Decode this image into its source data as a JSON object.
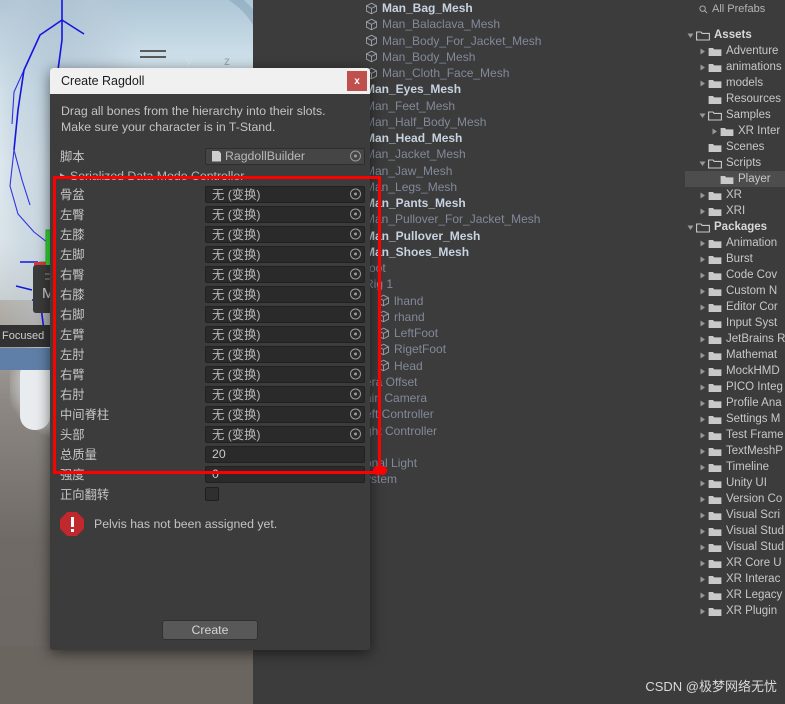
{
  "scene": {
    "gizmo_y": "y",
    "gizmo_z": "z",
    "mini_panel_label": "M",
    "focused_label": "Focused"
  },
  "dialog": {
    "title": "Create Ragdoll",
    "close_label": "x",
    "help_line1": "Drag all bones from the hierarchy into their slots.",
    "help_line2": "Make sure your character is in T-Stand.",
    "script_label": "脚本",
    "script_value": "RagdollBuilder",
    "section_header": "Serialized Data Mode Controller",
    "empty_value": "无 (变换)",
    "bone_rows": [
      {
        "label": "骨盆",
        "value": "无 (变换)"
      },
      {
        "label": "左臀",
        "value": "无 (变换)"
      },
      {
        "label": "左膝",
        "value": "无 (变换)"
      },
      {
        "label": "左脚",
        "value": "无 (变换)"
      },
      {
        "label": "右臀",
        "value": "无 (变换)"
      },
      {
        "label": "右膝",
        "value": "无 (变换)"
      },
      {
        "label": "右脚",
        "value": "无 (变换)"
      },
      {
        "label": "左臂",
        "value": "无 (变换)"
      },
      {
        "label": "左肘",
        "value": "无 (变换)"
      },
      {
        "label": "右臂",
        "value": "无 (变换)"
      },
      {
        "label": "右肘",
        "value": "无 (变换)"
      },
      {
        "label": "中间脊柱",
        "value": "无 (变换)"
      },
      {
        "label": "头部",
        "value": "无 (变换)"
      }
    ],
    "total_mass_label": "总质量",
    "total_mass_value": "20",
    "strength_label": "强度",
    "strength_value": "0",
    "flip_forward_label": "正向翻转",
    "warning_text": "Pelvis has not been assigned yet.",
    "create_label": "Create"
  },
  "hierarchy": {
    "rows": [
      {
        "label": "Man_Bag_Mesh",
        "style": "bright",
        "icon": true,
        "indent": 1
      },
      {
        "label": "Man_Balaclava_Mesh",
        "style": "dim",
        "icon": true,
        "indent": 1
      },
      {
        "label": "Man_Body_For_Jacket_Mesh",
        "style": "dim",
        "icon": true,
        "indent": 1
      },
      {
        "label": "Man_Body_Mesh",
        "style": "dim",
        "icon": true,
        "indent": 1
      },
      {
        "label": "Man_Cloth_Face_Mesh",
        "style": "dim",
        "icon": true,
        "indent": 1
      },
      {
        "label": "Man_Eyes_Mesh",
        "style": "bright",
        "icon": false,
        "indent": 1
      },
      {
        "label": "Man_Feet_Mesh",
        "style": "dim",
        "icon": false,
        "indent": 1
      },
      {
        "label": "Man_Half_Body_Mesh",
        "style": "dim",
        "icon": false,
        "indent": 1
      },
      {
        "label": "Man_Head_Mesh",
        "style": "bright",
        "icon": false,
        "indent": 1
      },
      {
        "label": "Man_Jacket_Mesh",
        "style": "dim",
        "icon": false,
        "indent": 1
      },
      {
        "label": "Man_Jaw_Mesh",
        "style": "dim",
        "icon": false,
        "indent": 1
      },
      {
        "label": "Man_Legs_Mesh",
        "style": "dim",
        "icon": false,
        "indent": 1
      },
      {
        "label": "Man_Pants_Mesh",
        "style": "bright",
        "icon": false,
        "indent": 1
      },
      {
        "label": "Man_Pullover_For_Jacket_Mesh",
        "style": "dim",
        "icon": false,
        "indent": 1
      },
      {
        "label": "Man_Pullover_Mesh",
        "style": "bright",
        "icon": false,
        "indent": 1
      },
      {
        "label": "Man_Shoes_Mesh",
        "style": "bright",
        "icon": false,
        "indent": 1
      },
      {
        "label": "root",
        "style": "dim",
        "icon": false,
        "indent": 1
      },
      {
        "label": "Rig 1",
        "style": "dim",
        "icon": false,
        "indent": 1
      },
      {
        "label": "lhand",
        "style": "dim",
        "icon": true,
        "indent": 2
      },
      {
        "label": "rhand",
        "style": "dim",
        "icon": true,
        "indent": 2
      },
      {
        "label": "LeftFoot",
        "style": "dim",
        "icon": true,
        "indent": 2
      },
      {
        "label": "RigetFoot",
        "style": "dim",
        "icon": true,
        "indent": 2
      },
      {
        "label": "Head",
        "style": "dim",
        "icon": true,
        "indent": 2
      },
      {
        "label": "era Offset",
        "style": "dim",
        "icon": false,
        "indent": 1
      },
      {
        "label": "ain Camera",
        "style": "dim",
        "icon": false,
        "indent": 1
      },
      {
        "label": "eft Controller",
        "style": "dim",
        "icon": false,
        "indent": 1
      },
      {
        "label": "ght Controller",
        "style": "dim",
        "icon": false,
        "indent": 1
      },
      {
        "label": "",
        "style": "dim",
        "icon": false,
        "indent": 1
      },
      {
        "label": "onal Light",
        "style": "dim",
        "icon": false,
        "indent": 1
      },
      {
        "label": "ystem",
        "style": "dim",
        "icon": false,
        "indent": 1
      }
    ]
  },
  "project": {
    "search_label": "All Prefabs",
    "rows": [
      {
        "label": "Assets",
        "indent": 0,
        "arrow": "down",
        "folder": "open",
        "bold": true,
        "selected": false
      },
      {
        "label": "Adventure",
        "indent": 1,
        "arrow": "right",
        "folder": "closed",
        "bold": false,
        "selected": false
      },
      {
        "label": "animations",
        "indent": 1,
        "arrow": "right",
        "folder": "closed",
        "bold": false,
        "selected": false
      },
      {
        "label": "models",
        "indent": 1,
        "arrow": "right",
        "folder": "closed",
        "bold": false,
        "selected": false
      },
      {
        "label": "Resources",
        "indent": 1,
        "arrow": "none",
        "folder": "closed",
        "bold": false,
        "selected": false
      },
      {
        "label": "Samples",
        "indent": 1,
        "arrow": "down",
        "folder": "open",
        "bold": false,
        "selected": false
      },
      {
        "label": "XR Inter",
        "indent": 2,
        "arrow": "right",
        "folder": "closed",
        "bold": false,
        "selected": false
      },
      {
        "label": "Scenes",
        "indent": 1,
        "arrow": "none",
        "folder": "closed",
        "bold": false,
        "selected": false
      },
      {
        "label": "Scripts",
        "indent": 1,
        "arrow": "down",
        "folder": "open",
        "bold": false,
        "selected": false
      },
      {
        "label": "Player",
        "indent": 2,
        "arrow": "none",
        "folder": "closed",
        "bold": false,
        "selected": true
      },
      {
        "label": "XR",
        "indent": 1,
        "arrow": "right",
        "folder": "closed",
        "bold": false,
        "selected": false
      },
      {
        "label": "XRI",
        "indent": 1,
        "arrow": "right",
        "folder": "closed",
        "bold": false,
        "selected": false
      },
      {
        "label": "Packages",
        "indent": 0,
        "arrow": "down",
        "folder": "open",
        "bold": true,
        "selected": false
      },
      {
        "label": "Animation",
        "indent": 1,
        "arrow": "right",
        "folder": "closed",
        "bold": false,
        "selected": false
      },
      {
        "label": "Burst",
        "indent": 1,
        "arrow": "right",
        "folder": "closed",
        "bold": false,
        "selected": false
      },
      {
        "label": "Code Cov",
        "indent": 1,
        "arrow": "right",
        "folder": "closed",
        "bold": false,
        "selected": false
      },
      {
        "label": "Custom N",
        "indent": 1,
        "arrow": "right",
        "folder": "closed",
        "bold": false,
        "selected": false
      },
      {
        "label": "Editor Cor",
        "indent": 1,
        "arrow": "right",
        "folder": "closed",
        "bold": false,
        "selected": false
      },
      {
        "label": "Input Syst",
        "indent": 1,
        "arrow": "right",
        "folder": "closed",
        "bold": false,
        "selected": false
      },
      {
        "label": "JetBrains R",
        "indent": 1,
        "arrow": "right",
        "folder": "closed",
        "bold": false,
        "selected": false
      },
      {
        "label": "Mathemat",
        "indent": 1,
        "arrow": "right",
        "folder": "closed",
        "bold": false,
        "selected": false
      },
      {
        "label": "MockHMD",
        "indent": 1,
        "arrow": "right",
        "folder": "closed",
        "bold": false,
        "selected": false
      },
      {
        "label": "PICO Integ",
        "indent": 1,
        "arrow": "right",
        "folder": "closed",
        "bold": false,
        "selected": false
      },
      {
        "label": "Profile Ana",
        "indent": 1,
        "arrow": "right",
        "folder": "closed",
        "bold": false,
        "selected": false
      },
      {
        "label": "Settings M",
        "indent": 1,
        "arrow": "right",
        "folder": "closed",
        "bold": false,
        "selected": false
      },
      {
        "label": "Test Frame",
        "indent": 1,
        "arrow": "right",
        "folder": "closed",
        "bold": false,
        "selected": false
      },
      {
        "label": "TextMeshP",
        "indent": 1,
        "arrow": "right",
        "folder": "closed",
        "bold": false,
        "selected": false
      },
      {
        "label": "Timeline",
        "indent": 1,
        "arrow": "right",
        "folder": "closed",
        "bold": false,
        "selected": false
      },
      {
        "label": "Unity UI",
        "indent": 1,
        "arrow": "right",
        "folder": "closed",
        "bold": false,
        "selected": false
      },
      {
        "label": "Version Co",
        "indent": 1,
        "arrow": "right",
        "folder": "closed",
        "bold": false,
        "selected": false
      },
      {
        "label": "Visual Scri",
        "indent": 1,
        "arrow": "right",
        "folder": "closed",
        "bold": false,
        "selected": false
      },
      {
        "label": "Visual Stud",
        "indent": 1,
        "arrow": "right",
        "folder": "closed",
        "bold": false,
        "selected": false
      },
      {
        "label": "Visual Stud",
        "indent": 1,
        "arrow": "right",
        "folder": "closed",
        "bold": false,
        "selected": false
      },
      {
        "label": "XR Core U",
        "indent": 1,
        "arrow": "right",
        "folder": "closed",
        "bold": false,
        "selected": false
      },
      {
        "label": "XR Interac",
        "indent": 1,
        "arrow": "right",
        "folder": "closed",
        "bold": false,
        "selected": false
      },
      {
        "label": "XR Legacy",
        "indent": 1,
        "arrow": "right",
        "folder": "closed",
        "bold": false,
        "selected": false
      },
      {
        "label": "XR Plugin",
        "indent": 1,
        "arrow": "right",
        "folder": "closed",
        "bold": false,
        "selected": false
      }
    ]
  },
  "watermark": {
    "text": "CSDN @极梦网络无忧"
  },
  "colors": {
    "accent_red": "#ff0000",
    "close_red": "#c0504d",
    "error_red": "#c1282d",
    "panel_bg": "#3c3c3c",
    "field_bg": "#2a2a2a",
    "selected_row": "#4d4d4d"
  }
}
